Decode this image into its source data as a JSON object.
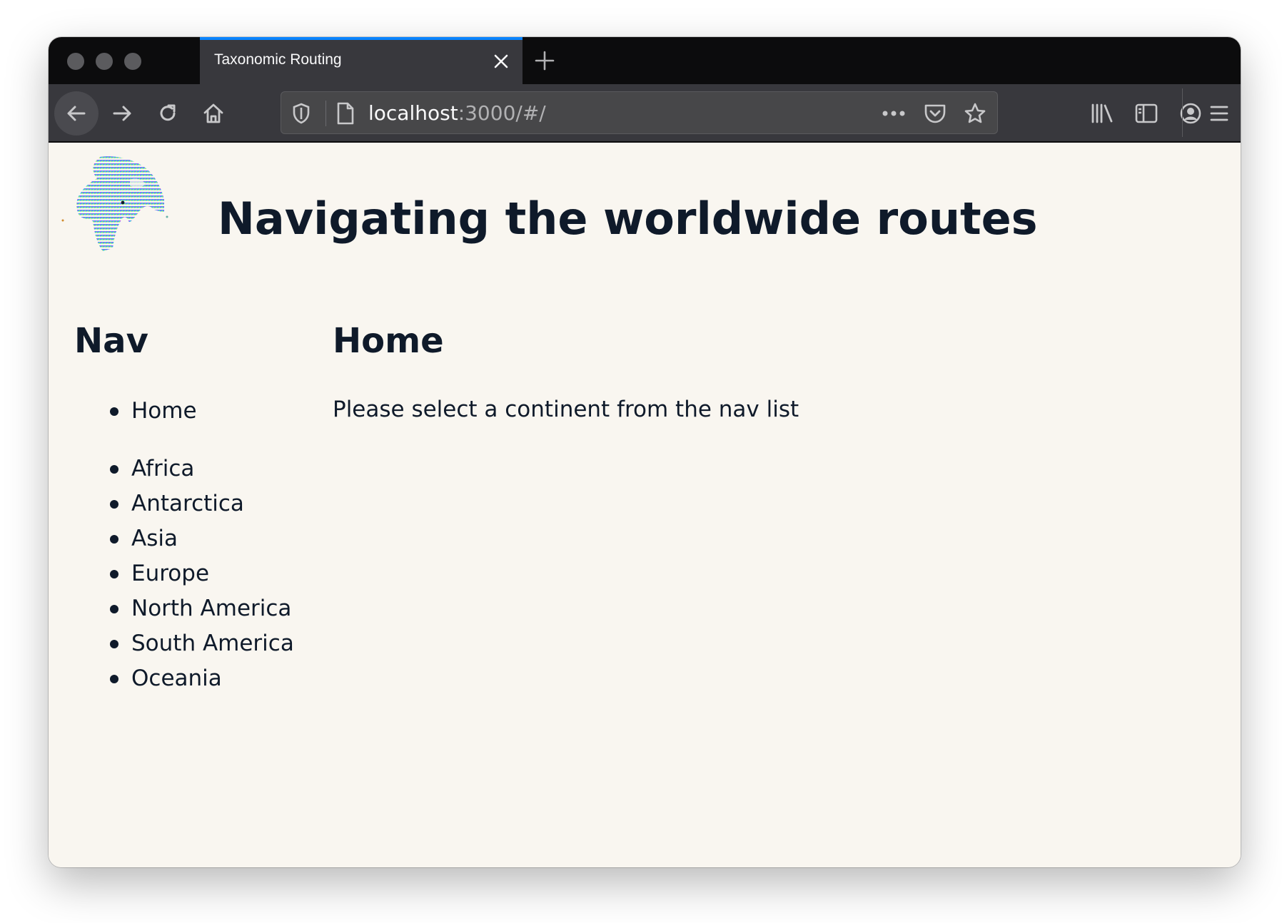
{
  "browser": {
    "tab_title": "Taxonomic Routing",
    "url_host": "localhost",
    "url_rest": ":3000/#/"
  },
  "header": {
    "title": "Navigating the worldwide routes"
  },
  "nav": {
    "heading": "Nav",
    "home": "Home",
    "items": [
      "Africa",
      "Antarctica",
      "Asia",
      "Europe",
      "North America",
      "South America",
      "Oceania"
    ]
  },
  "main": {
    "heading": "Home",
    "text": "Please select a continent from the nav list"
  }
}
